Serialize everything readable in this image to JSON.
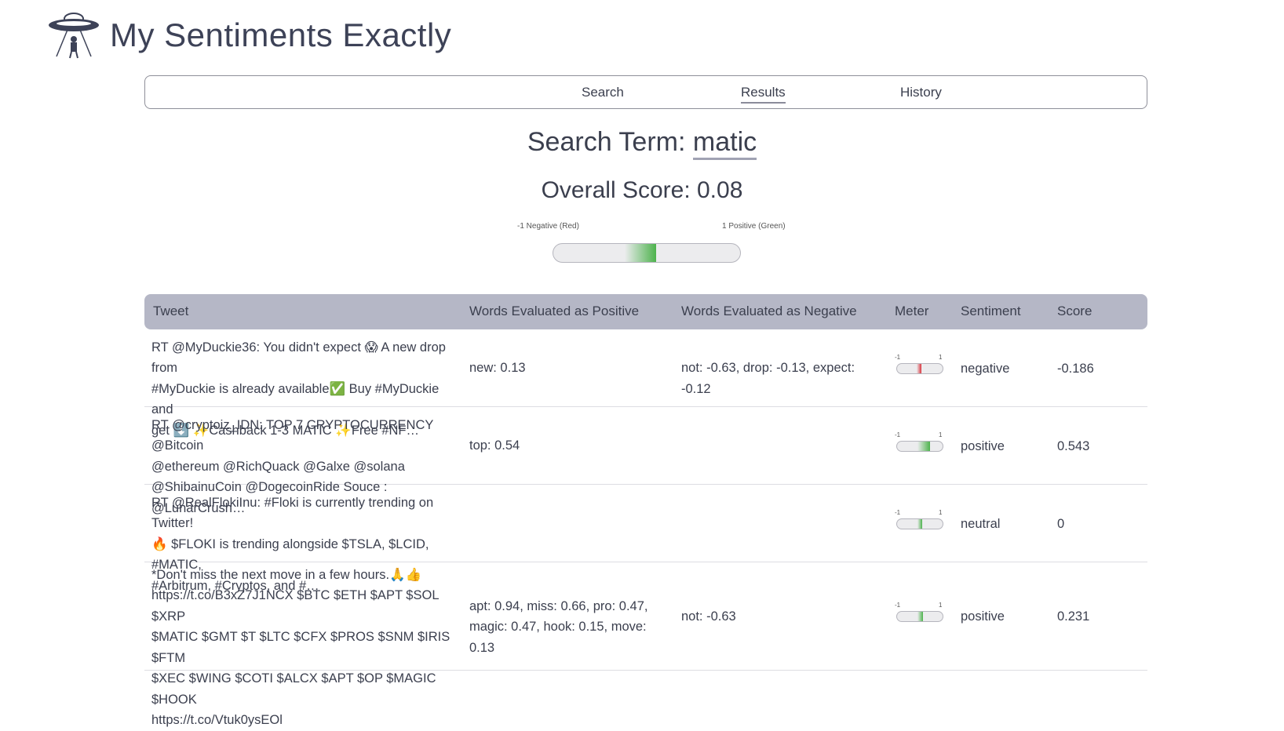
{
  "app": {
    "title": "My Sentiments Exactly"
  },
  "nav": {
    "items": [
      {
        "label": "Search"
      },
      {
        "label": "Results"
      },
      {
        "label": "History"
      }
    ]
  },
  "search": {
    "prefix": "Search Term:",
    "term": "matic"
  },
  "overall": {
    "text": "Overall Score: 0.08",
    "value": 0.08
  },
  "scale": {
    "negative_label": "-1 Negative (Red)",
    "positive_label": "1 Positive (Green)",
    "min_label": "-1",
    "max_label": "1"
  },
  "colors": {
    "positive": "#4db34d",
    "negative": "#d9343d",
    "header_bg": "#b5b7c6",
    "text": "#3b3f4e"
  },
  "table": {
    "headers": [
      "Tweet",
      "Words Evaluated as Positive",
      "Words Evaluated as Negative",
      "Meter",
      "Sentiment",
      "Score"
    ],
    "rows": [
      {
        "tweet_lines": [
          "RT @MyDuckie36: You didn't expect 😱 A new drop from",
          "#MyDuckie is already available✅ Buy #MyDuckie and",
          "get ⬇️ ✨Cashback 1-3 MATIC ✨Free #NF…"
        ],
        "positive_words": [
          "new: 0.13"
        ],
        "negative_words": [
          "not: -0.63, drop: -0.13, expect: -0.12"
        ],
        "sentiment": "negative",
        "score": "-0.186",
        "meter_value": -0.186
      },
      {
        "tweet_lines": [
          "RT @cryptoiz_IDN: TOP 7 CRYPTOCURRENCY @Bitcoin",
          "@ethereum @RichQuack @Galxe @solana",
          "@ShibainuCoin @DogecoinRide Souce : @LunarCrush…"
        ],
        "positive_words": [
          "top: 0.54"
        ],
        "negative_words": [],
        "sentiment": "positive",
        "score": "0.543",
        "meter_value": 0.543
      },
      {
        "tweet_lines": [
          "RT @RealFlokiInu: #Floki is currently trending on Twitter!",
          "🔥 $FLOKI is trending alongside $TSLA, $LCID, #MATIC,",
          "#Arbitrum, #Cryptos, and #…"
        ],
        "positive_words": [],
        "negative_words": [],
        "sentiment": "neutral",
        "score": "0",
        "meter_value": 0
      },
      {
        "tweet_lines": [
          "*Don't miss the next move in a few hours.🙏👍",
          "https://t.co/B3xZ7J1NCX $BTC $ETH $APT $SOL $XRP",
          "$MATIC $GMT $T $LTC $CFX $PROS $SNM $IRIS $FTM",
          "$XEC $WING $COTI $ALCX $APT $OP $MAGIC $HOOK",
          "https://t.co/Vtuk0ysEOl"
        ],
        "positive_words": [
          "apt: 0.94, miss: 0.66, pro: 0.47,",
          "magic: 0.47, hook: 0.15, move: 0.13"
        ],
        "negative_words": [
          "not: -0.63"
        ],
        "sentiment": "positive",
        "score": "0.231",
        "meter_value": 0.231
      }
    ]
  }
}
